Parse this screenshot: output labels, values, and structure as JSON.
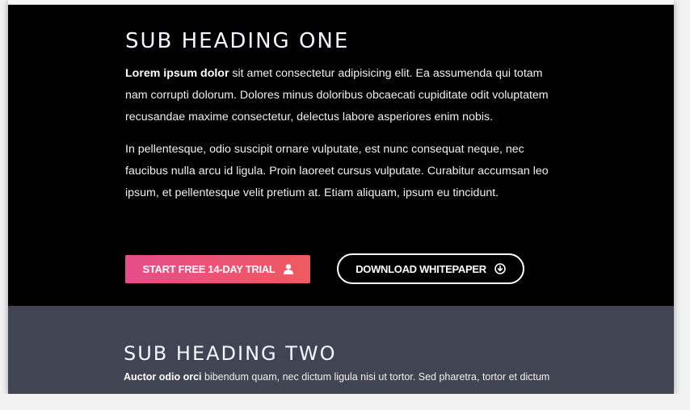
{
  "section_one": {
    "heading": "SUB HEADING ONE",
    "para1_bold": "Lorem ipsum dolor",
    "para1_rest": " sit amet consectetur adipisicing elit. Ea assumenda qui totam nam corrupti dolorum. Dolores minus doloribus obcaecati cupiditate odit voluptatem recusandae maxime consectetur, delectus labore asperiores enim nobis.",
    "para2": "In pellentesque, odio suscipit ornare vulputate, est nunc consequat neque, nec faucibus nulla arcu id ligula. Proin laoreet cursus vulputate. Curabitur accumsan leo ipsum, et pellentesque velit pretium at. Etiam aliquam, ipsum eu tincidunt.",
    "trial_button": "START FREE 14-DAY TRIAL",
    "download_button": "DOWNLOAD WHITEPAPER"
  },
  "section_two": {
    "heading": "SUB HEADING TWO",
    "para1_bold": "Auctor odio orci",
    "para1_rest": " bibendum quam, nec dictum ligula nisi ut tortor. Sed pharetra, tortor et dictum"
  },
  "colors": {
    "section_one_bg": "#000000",
    "section_two_bg": "#414452",
    "trial_gradient_start": "#e64d8a",
    "trial_gradient_end": "#ef5a5f"
  },
  "icons": {
    "trial": "user-icon",
    "download": "download-circle-icon"
  }
}
